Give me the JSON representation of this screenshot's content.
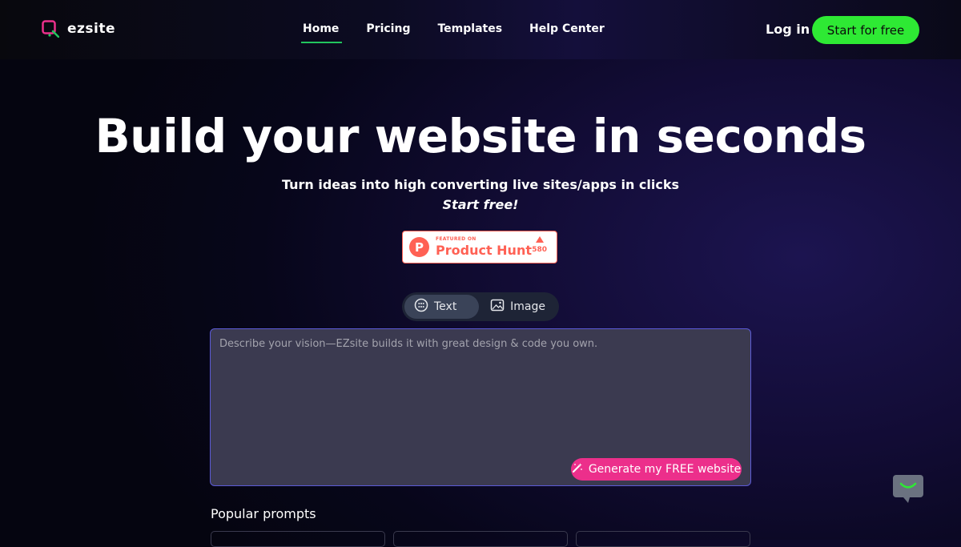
{
  "header": {
    "brand": "ezsite",
    "nav": [
      {
        "label": "Home",
        "active": true
      },
      {
        "label": "Pricing",
        "active": false
      },
      {
        "label": "Templates",
        "active": false
      },
      {
        "label": "Help Center",
        "active": false
      }
    ],
    "login_label": "Log in",
    "start_label": "Start for free"
  },
  "hero": {
    "title": "Build your website in seconds",
    "subtitle": "Turn ideas into high converting live sites/apps in clicks",
    "cta_text": "Start free!"
  },
  "product_hunt": {
    "featured": "FEATURED ON",
    "name": "Product Hunt",
    "votes": "580"
  },
  "mode_tabs": [
    {
      "label": "Text",
      "icon": "emoji-icon",
      "active": true
    },
    {
      "label": "Image",
      "icon": "image-icon",
      "active": false
    }
  ],
  "prompt": {
    "placeholder": "Describe your vision—EZsite builds it with great design & code you own.",
    "generate_label": "Generate my FREE website"
  },
  "popular": {
    "heading": "Popular prompts"
  },
  "colors": {
    "accent_green": "#2ee934",
    "accent_pink": "#ec2f8b",
    "producthunt": "#ff6154"
  }
}
